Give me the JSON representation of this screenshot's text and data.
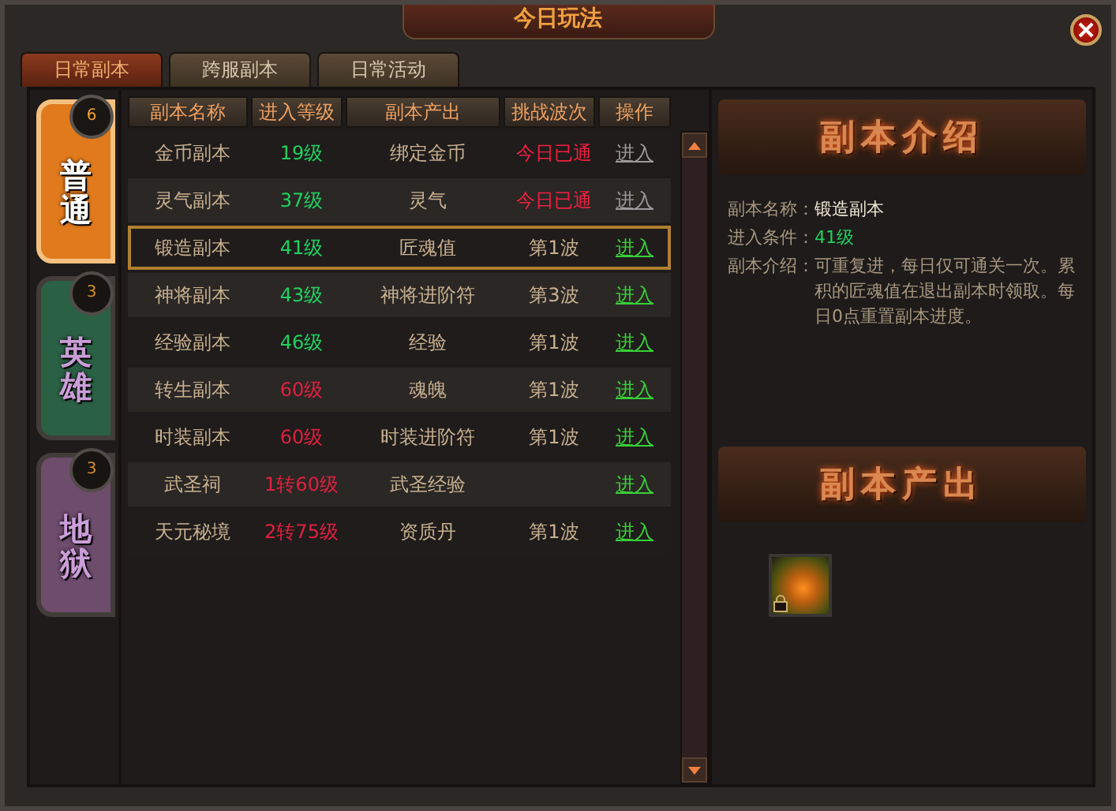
{
  "window": {
    "title": "今日玩法"
  },
  "tabs": [
    {
      "label": "日常副本",
      "selected": true
    },
    {
      "label": "跨服副本",
      "selected": false
    },
    {
      "label": "日常活动",
      "selected": false
    }
  ],
  "categories": [
    {
      "label": "普通",
      "count": "6",
      "color": "#e07a1c",
      "selected": true
    },
    {
      "label": "英雄",
      "count": "3",
      "color": "#2f6b4c",
      "selected": false
    },
    {
      "label": "地狱",
      "count": "3",
      "color": "#7a5478",
      "selected": false
    }
  ],
  "table": {
    "columns": [
      "副本名称",
      "进入等级",
      "副本产出",
      "挑战波次",
      "操作"
    ],
    "rows": [
      {
        "name": "金币副本",
        "level": "19级",
        "level_met": true,
        "output": "绑定金币",
        "wave": "今日已通",
        "cleared": true,
        "action": "进入",
        "disabled": true,
        "selected": false
      },
      {
        "name": "灵气副本",
        "level": "37级",
        "level_met": true,
        "output": "灵气",
        "wave": "今日已通",
        "cleared": true,
        "action": "进入",
        "disabled": true,
        "selected": false
      },
      {
        "name": "锻造副本",
        "level": "41级",
        "level_met": true,
        "output": "匠魂值",
        "wave": "第1波",
        "cleared": false,
        "action": "进入",
        "disabled": false,
        "selected": true
      },
      {
        "name": "神将副本",
        "level": "43级",
        "level_met": true,
        "output": "神将进阶符",
        "wave": "第3波",
        "cleared": false,
        "action": "进入",
        "disabled": false,
        "selected": false
      },
      {
        "name": "经验副本",
        "level": "46级",
        "level_met": true,
        "output": "经验",
        "wave": "第1波",
        "cleared": false,
        "action": "进入",
        "disabled": false,
        "selected": false
      },
      {
        "name": "转生副本",
        "level": "60级",
        "level_met": false,
        "output": "魂魄",
        "wave": "第1波",
        "cleared": false,
        "action": "进入",
        "disabled": false,
        "selected": false
      },
      {
        "name": "时装副本",
        "level": "60级",
        "level_met": false,
        "output": "时装进阶符",
        "wave": "第1波",
        "cleared": false,
        "action": "进入",
        "disabled": false,
        "selected": false
      },
      {
        "name": "武圣祠",
        "level": "1转60级",
        "level_met": false,
        "output": "武圣经验",
        "action": "进入",
        "disabled": false,
        "selected": false
      },
      {
        "name": "天元秘境",
        "level": "2转75级",
        "level_met": false,
        "output": "资质丹",
        "wave": "第1波",
        "cleared": false,
        "action": "进入",
        "disabled": false,
        "selected": false
      }
    ]
  },
  "details": {
    "banner": "副本介绍",
    "fields": [
      {
        "label": "副本名称：",
        "value": "锻造副本",
        "kind": "name"
      },
      {
        "label": "进入条件：",
        "value": "41级",
        "kind": "level"
      },
      {
        "label": "副本介绍：",
        "value": "可重复进，每日仅可通关一次。累积的匠魂值在退出副本时领取。每日0点重置副本进度。",
        "kind": "text"
      }
    ]
  },
  "rewards": {
    "banner": "副本产出",
    "items": [
      {
        "locked": true
      }
    ]
  }
}
